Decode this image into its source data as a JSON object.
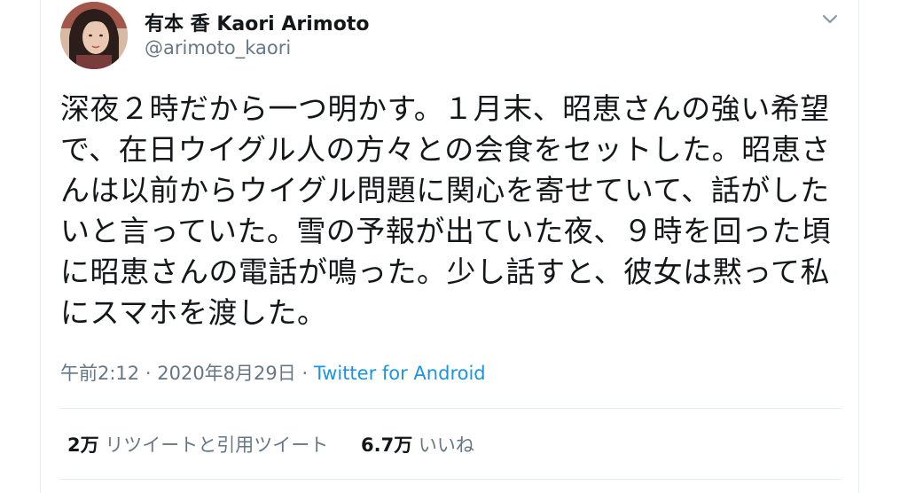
{
  "user": {
    "display_name": "有本 香 Kaori Arimoto",
    "handle": "@arimoto_kaori"
  },
  "tweet": {
    "text": "深夜２時だから一つ明かす。１月末、昭恵さんの強い希望で、在日ウイグル人の方々との会食をセットした。昭恵さんは以前からウイグル問題に関心を寄せていて、話がしたいと言っていた。雪の予報が出ていた夜、９時を回った頃に昭恵さんの電話が鳴った。少し話すと、彼女は黙って私にスマホを渡した。",
    "time": "午前2:12",
    "date": "2020年8月29日",
    "source": "Twitter for Android",
    "separator": "·"
  },
  "stats": {
    "retweets_count": "2万",
    "retweets_label": "リツイートと引用ツイート",
    "likes_count": "6.7万",
    "likes_label": "いいね"
  },
  "icons": {
    "more": "chevron-down-icon"
  },
  "colors": {
    "text": "#14171a",
    "secondary": "#657786",
    "link": "#1b95e0",
    "border": "#e6ecf0"
  }
}
